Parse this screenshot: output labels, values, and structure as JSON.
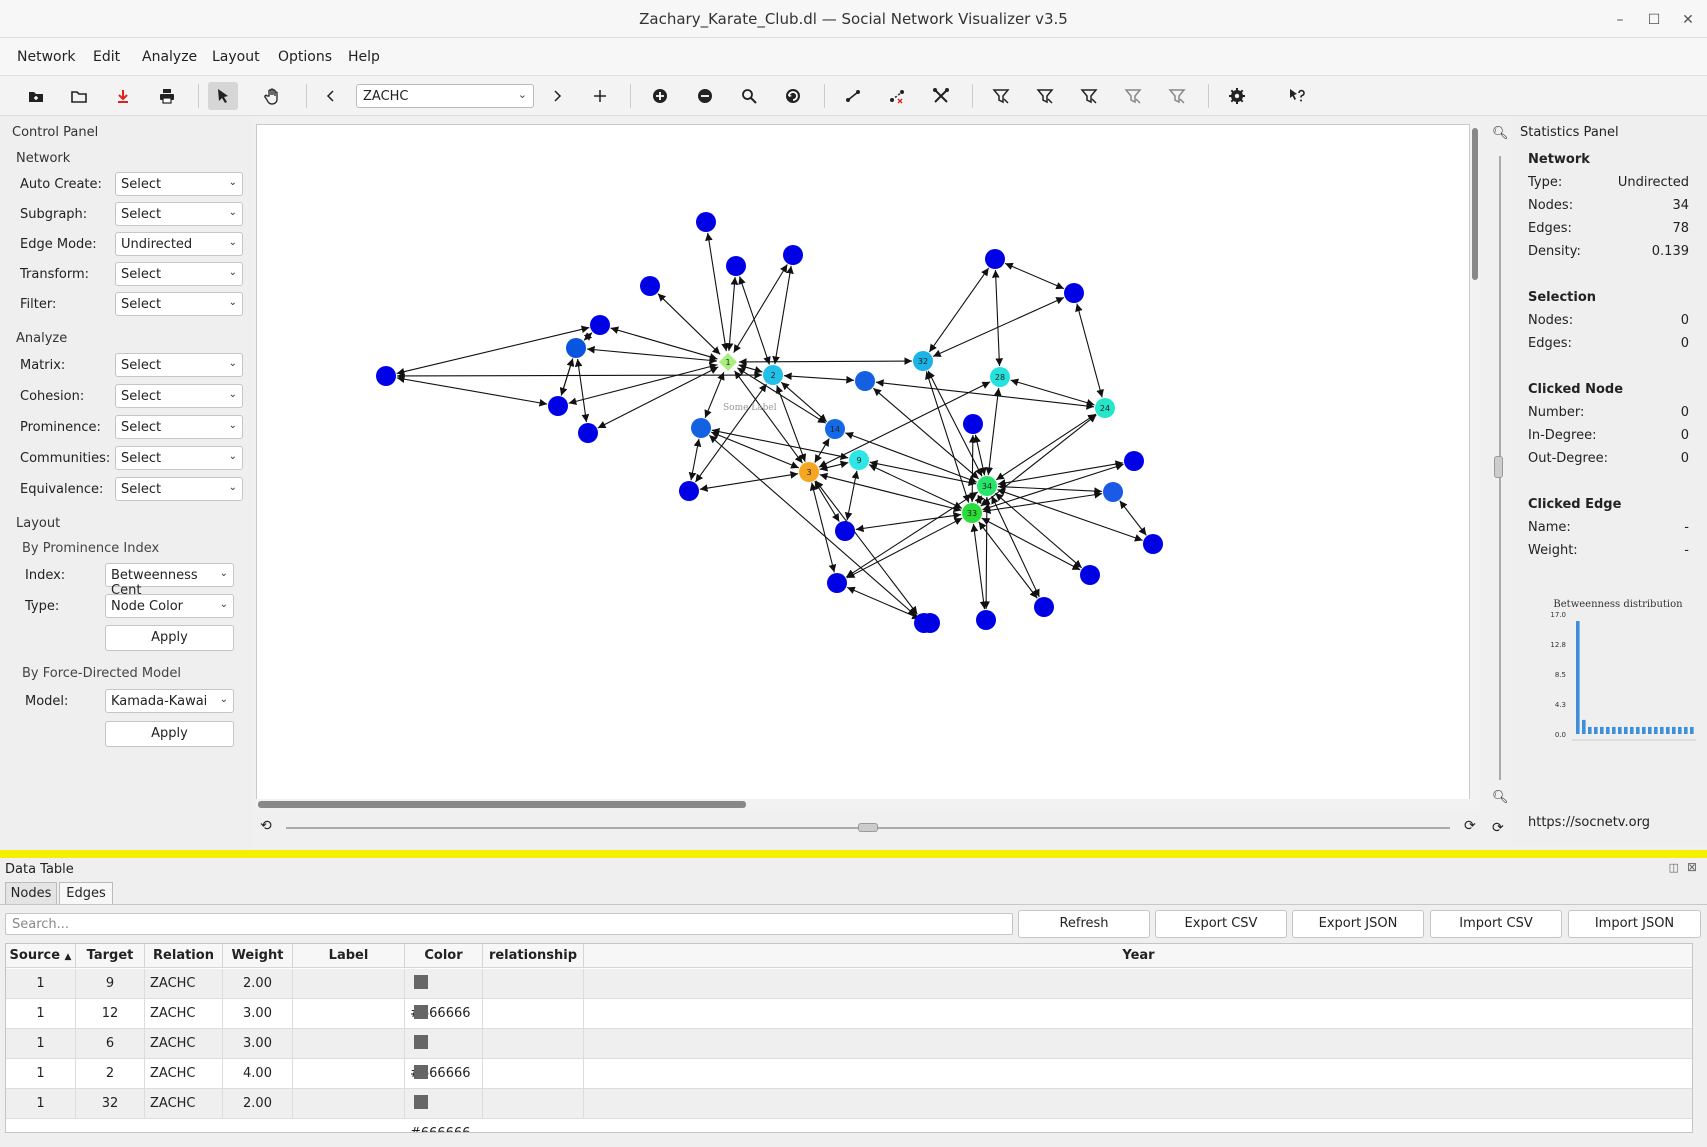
{
  "window": {
    "title": "Zachary_Karate_Club.dl — Social Network Visualizer v3.5"
  },
  "menu": [
    "Network",
    "Edit",
    "Analyze",
    "Layout",
    "Options",
    "Help"
  ],
  "toolbar": {
    "relation_value": "ZACHC",
    "icons": [
      "new-network-icon",
      "open-folder-icon",
      "save-icon",
      "print-icon",
      "select-pointer-icon",
      "pan-hand-icon",
      "prev-relation-icon",
      "next-relation-icon",
      "add-relation-icon",
      "zoom-in-icon",
      "zoom-out-icon",
      "find-node-icon",
      "rotate-icon",
      "add-edge-icon",
      "remove-edge-icon",
      "edge-tools-icon",
      "filter-1-icon",
      "filter-2-icon",
      "filter-3-icon",
      "filter-4-icon",
      "filter-5-icon",
      "settings-icon",
      "whats-this-icon"
    ]
  },
  "control_panel": {
    "title": "Control Panel",
    "network_section": "Network",
    "auto_create_label": "Auto Create:",
    "auto_create_value": "Select",
    "subgraph_label": "Subgraph:",
    "subgraph_value": "Select",
    "edge_mode_label": "Edge Mode:",
    "edge_mode_value": "Undirected",
    "transform_label": "Transform:",
    "transform_value": "Select",
    "filter_label": "Filter:",
    "filter_value": "Select",
    "analyze_section": "Analyze",
    "matrix_label": "Matrix:",
    "matrix_value": "Select",
    "cohesion_label": "Cohesion:",
    "cohesion_value": "Select",
    "prominence_label": "Prominence:",
    "prominence_value": "Select",
    "communities_label": "Communities:",
    "communities_value": "Select",
    "equivalence_label": "Equivalence:",
    "equivalence_value": "Select",
    "layout_section": "Layout",
    "by_prominence": "By Prominence Index",
    "index_label": "Index:",
    "index_value": "Betweenness Cent",
    "type_label": "Type:",
    "type_value": "Node Color",
    "apply_label": "Apply",
    "by_force": "By Force-Directed Model",
    "model_label": "Model:",
    "model_value": "Kamada-Kawai",
    "apply2_label": "Apply"
  },
  "canvas": {
    "watermark": "Some Label",
    "nodes": [
      {
        "id": "1",
        "label": "1",
        "color": "#a8ee7c",
        "shape": "diamond"
      },
      {
        "id": "2",
        "label": "2",
        "color": "#22c0e8"
      },
      {
        "id": "3",
        "label": "3",
        "color": "#f5a623"
      },
      {
        "id": "9",
        "label": "9",
        "color": "#2fe6e6"
      },
      {
        "id": "14",
        "label": "14",
        "color": "#1469e6"
      },
      {
        "id": "24",
        "label": "24",
        "color": "#25e6c8"
      },
      {
        "id": "28",
        "label": "28",
        "color": "#25e2df"
      },
      {
        "id": "30",
        "label": "",
        "color": "#1460e0"
      },
      {
        "id": "32",
        "label": "32",
        "color": "#1ab4e6"
      },
      {
        "id": "33",
        "label": "33",
        "color": "#2add3a"
      },
      {
        "id": "34",
        "label": "34",
        "color": "#27e46a"
      },
      {
        "id": "4",
        "label": "",
        "color": "#0a55e0"
      },
      {
        "id": "8",
        "label": "",
        "color": "#1462e2"
      },
      {
        "id": "n_a",
        "label": "",
        "color": "#0000e6"
      },
      {
        "id": "n_b",
        "label": "",
        "color": "#0000e6"
      },
      {
        "id": "n_c",
        "label": "",
        "color": "#0000e6"
      },
      {
        "id": "n_d",
        "label": "",
        "color": "#0000e6"
      },
      {
        "id": "n_e",
        "label": "",
        "color": "#0000e6"
      },
      {
        "id": "n_f",
        "label": "",
        "color": "#0000e6"
      },
      {
        "id": "n_g",
        "label": "",
        "color": "#0000e6"
      },
      {
        "id": "n_h",
        "label": "",
        "color": "#0000e6"
      },
      {
        "id": "n_i",
        "label": "",
        "color": "#0000e6"
      },
      {
        "id": "n_j",
        "label": "",
        "color": "#0000e6"
      },
      {
        "id": "n_k",
        "label": "",
        "color": "#0000e6"
      },
      {
        "id": "n_l",
        "label": "",
        "color": "#0000e6"
      },
      {
        "id": "n_m",
        "label": "",
        "color": "#0000e6"
      },
      {
        "id": "n_n",
        "label": "",
        "color": "#0000e6"
      },
      {
        "id": "n_o",
        "label": "",
        "color": "#0000e6"
      },
      {
        "id": "n_p",
        "label": "",
        "color": "#0000e6"
      },
      {
        "id": "n_q",
        "label": "",
        "color": "#0000e6"
      },
      {
        "id": "n_r",
        "label": "",
        "color": "#0000e6"
      },
      {
        "id": "n_s",
        "label": "",
        "color": "#0000e6"
      },
      {
        "id": "n_t",
        "label": "",
        "color": "#0000e6"
      },
      {
        "id": "n_u",
        "label": "",
        "color": "#1a5ae6"
      }
    ],
    "edges": [
      [
        "1",
        "2"
      ],
      [
        "1",
        "3"
      ],
      [
        "1",
        "n_a"
      ],
      [
        "1",
        "n_b"
      ],
      [
        "1",
        "n_c"
      ],
      [
        "1",
        "n_d"
      ],
      [
        "1",
        "n_e"
      ],
      [
        "1",
        "4"
      ],
      [
        "1",
        "n_f"
      ],
      [
        "1",
        "n_g"
      ],
      [
        "1",
        "32"
      ],
      [
        "1",
        "14"
      ],
      [
        "1",
        "8"
      ],
      [
        "2",
        "3"
      ],
      [
        "2",
        "n_b"
      ],
      [
        "2",
        "n_c"
      ],
      [
        "2",
        "14"
      ],
      [
        "2",
        "n_h"
      ],
      [
        "2",
        "30"
      ],
      [
        "2",
        "n_i"
      ],
      [
        "3",
        "9"
      ],
      [
        "3",
        "14"
      ],
      [
        "3",
        "8"
      ],
      [
        "3",
        "n_i"
      ],
      [
        "3",
        "n_j"
      ],
      [
        "3",
        "28"
      ],
      [
        "3",
        "33"
      ],
      [
        "3",
        "n_k"
      ],
      [
        "3",
        "n_l"
      ],
      [
        "4",
        "n_e"
      ],
      [
        "4",
        "n_f"
      ],
      [
        "4",
        "n_g"
      ],
      [
        "n_e",
        "n_m"
      ],
      [
        "n_f",
        "n_m"
      ],
      [
        "4",
        "n_f"
      ],
      [
        "8",
        "n_l"
      ],
      [
        "8",
        "9"
      ],
      [
        "8",
        "n_i"
      ],
      [
        "9",
        "33"
      ],
      [
        "9",
        "34"
      ],
      [
        "9",
        "n_j"
      ],
      [
        "14",
        "34"
      ],
      [
        "30",
        "34"
      ],
      [
        "32",
        "33"
      ],
      [
        "32",
        "34"
      ],
      [
        "32",
        "n_n"
      ],
      [
        "32",
        "n_o"
      ],
      [
        "28",
        "34"
      ],
      [
        "28",
        "24"
      ],
      [
        "28",
        "n_n"
      ],
      [
        "24",
        "34"
      ],
      [
        "24",
        "33"
      ],
      [
        "24",
        "n_o"
      ],
      [
        "24",
        "30b"
      ],
      [
        "34",
        "33"
      ],
      [
        "34",
        "n_p"
      ],
      [
        "34",
        "n_q"
      ],
      [
        "34",
        "n_r"
      ],
      [
        "34",
        "n_s"
      ],
      [
        "34",
        "n_t"
      ],
      [
        "34",
        "n_u"
      ],
      [
        "34",
        "n_k"
      ],
      [
        "34",
        "n_q2"
      ],
      [
        "33",
        "n_p"
      ],
      [
        "33",
        "n_q"
      ],
      [
        "33",
        "n_s"
      ],
      [
        "33",
        "n_t"
      ],
      [
        "33",
        "n_r"
      ],
      [
        "33",
        "n_k"
      ],
      [
        "33",
        "n_u"
      ],
      [
        "33",
        "n_j"
      ],
      [
        "n_n",
        "n_o"
      ],
      [
        "n_u",
        "n_v"
      ],
      [
        "n_k",
        "n_w"
      ]
    ]
  },
  "stats": {
    "title": "Statistics Panel",
    "network_h": "Network",
    "type_l": "Type:",
    "type_v": "Undirected",
    "nodes_l": "Nodes:",
    "nodes_v": "34",
    "edges_l": "Edges:",
    "edges_v": "78",
    "density_l": "Density:",
    "density_v": "0.139",
    "selection_h": "Selection",
    "sel_nodes_l": "Nodes:",
    "sel_nodes_v": "0",
    "sel_edges_l": "Edges:",
    "sel_edges_v": "0",
    "clicked_node_h": "Clicked Node",
    "number_l": "Number:",
    "number_v": "0",
    "indeg_l": "In-Degree:",
    "indeg_v": "0",
    "outdeg_l": "Out-Degree:",
    "outdeg_v": "0",
    "clicked_edge_h": "Clicked Edge",
    "name_l": "Name:",
    "name_v": "-",
    "weight_l": "Weight:",
    "weight_v": "-",
    "url": "https://socnetv.org"
  },
  "chart_data": {
    "type": "bar",
    "title": "Betweenness distribution",
    "yticks": [
      "17.0",
      "12.8",
      "8.5",
      "4.3",
      "0.0"
    ],
    "ylim": [
      0,
      17.0
    ],
    "values": [
      16,
      2,
      1,
      1,
      1,
      1,
      1,
      1,
      1,
      1,
      1,
      1,
      1,
      1,
      1,
      1,
      1,
      1,
      1,
      1
    ],
    "color": "#3d8fd8"
  },
  "datatable": {
    "title": "Data Table",
    "tabs": [
      "Nodes",
      "Edges"
    ],
    "search_placeholder": "Search...",
    "buttons": [
      "Refresh",
      "Export CSV",
      "Export JSON",
      "Import CSV",
      "Import JSON"
    ],
    "columns": [
      "Source",
      "Target",
      "Relation",
      "Weight",
      "Label",
      "Color",
      "relationship",
      "Year"
    ],
    "rows": [
      [
        "1",
        "9",
        "ZACHC",
        "2.00",
        "",
        "#666666",
        "",
        ""
      ],
      [
        "1",
        "12",
        "ZACHC",
        "3.00",
        "",
        "#666666",
        "",
        ""
      ],
      [
        "1",
        "6",
        "ZACHC",
        "3.00",
        "",
        "#666666",
        "",
        ""
      ],
      [
        "1",
        "2",
        "ZACHC",
        "4.00",
        "",
        "#666666",
        "",
        ""
      ],
      [
        "1",
        "32",
        "ZACHC",
        "2.00",
        "",
        "#666666",
        "",
        ""
      ]
    ]
  }
}
